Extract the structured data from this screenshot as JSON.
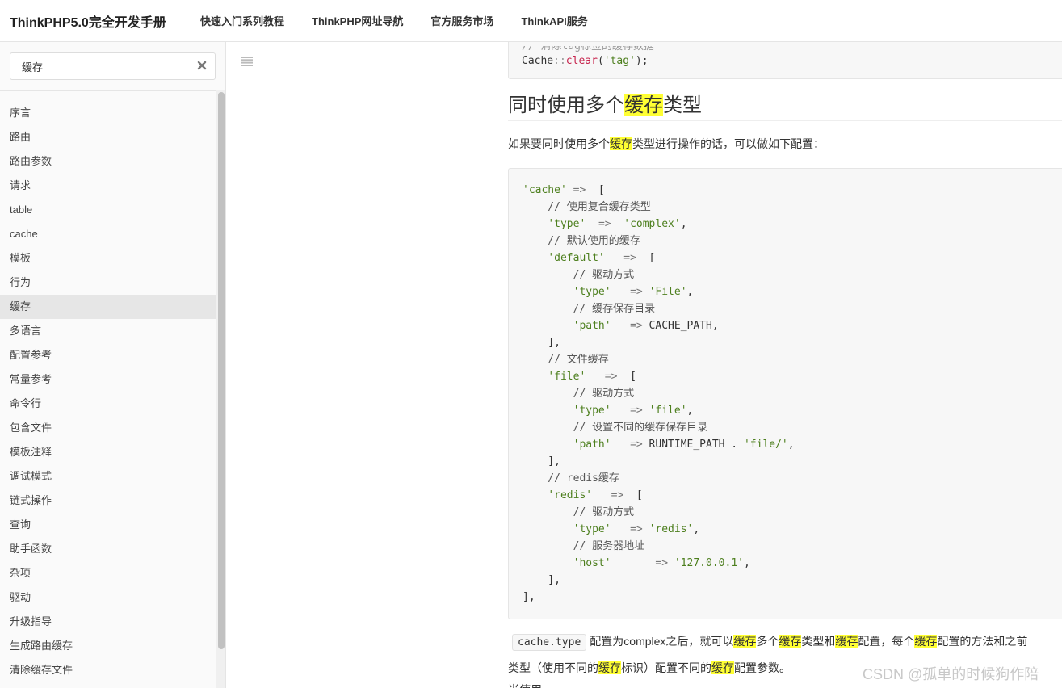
{
  "brand": "ThinkPHP5.0完全开发手册",
  "nav": [
    "快速入门系列教程",
    "ThinkPHP网址导航",
    "官方服务市场",
    "ThinkAPI服务"
  ],
  "search": {
    "value": "缓存"
  },
  "sidebar": {
    "items": [
      "序言",
      "路由",
      "路由参数",
      "请求",
      "table",
      "cache",
      "模板",
      "行为",
      "缓存",
      "多语言",
      "配置参考",
      "常量参考",
      "命令行",
      "包含文件",
      "模板注释",
      "调试模式",
      "链式操作",
      "查询",
      "助手函数",
      "杂项",
      "驱动",
      "升级指导",
      "生成路由缓存",
      "清除缓存文件"
    ],
    "active_index": 8
  },
  "code_top": {
    "comment": "// 清除tag标签的缓存数据",
    "line_a": "Cache",
    "line_b": "::",
    "line_c": "clear",
    "line_d": "(",
    "line_e": "'tag'",
    "line_f": ");"
  },
  "heading": {
    "pre": "同时使用多个",
    "hl": "缓存",
    "post": "类型"
  },
  "para1": {
    "pre": "如果要同时使用多个",
    "hl": "缓存",
    "post": "类型进行操作的话，可以做如下配置："
  },
  "code_lines": [
    "'cache' =>  [",
    "    // 使用复合缓存类型",
    "    'type'  =>  'complex',",
    "    // 默认使用的缓存",
    "    'default'   =>  [",
    "        // 驱动方式",
    "        'type'   => 'File',",
    "        // 缓存保存目录",
    "        'path'   => CACHE_PATH,",
    "    ],",
    "    // 文件缓存",
    "    'file'   =>  [",
    "        // 驱动方式",
    "        'type'   => 'file',",
    "        // 设置不同的缓存保存目录",
    "        'path'   => RUNTIME_PATH . 'file/',",
    "    ],",
    "    // redis缓存",
    "    'redis'   =>  [",
    "        // 驱动方式",
    "        'type'   => 'redis',",
    "        // 服务器地址",
    "        'host'       => '127.0.0.1',",
    "    ],",
    "],"
  ],
  "para2": {
    "code": "cache.type",
    "t1": "配置为complex之后，就可以",
    "h1": "缓存",
    "t2": "多个",
    "h2": "缓存",
    "t3": "类型和",
    "h3": "缓存",
    "t4": "配置，每个",
    "h4": "缓存",
    "t5": "配置的方法和之前"
  },
  "para3": {
    "t1": "类型（使用不同的",
    "h1": "缓存",
    "t2": "标识）配置不同的",
    "h2": "缓存",
    "t3": "配置参数。"
  },
  "para4": "当使用",
  "watermark": "CSDN @孤单的时候狗作陪"
}
